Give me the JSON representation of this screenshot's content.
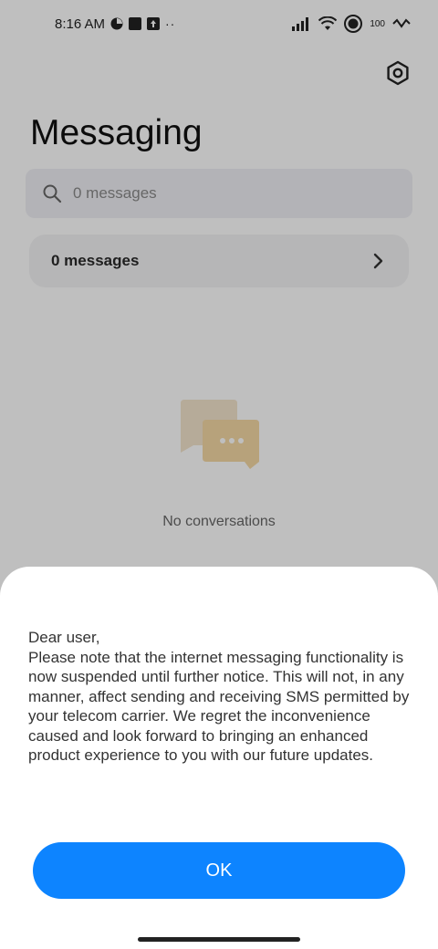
{
  "status_bar": {
    "time": "8:16 AM",
    "battery": "100"
  },
  "header": {
    "title": "Messaging"
  },
  "search": {
    "placeholder": "0 messages"
  },
  "messages_row": {
    "label": "0 messages"
  },
  "empty_state": {
    "text": "No conversations"
  },
  "dialog": {
    "body": "Dear user,\nPlease note that the internet messaging functionality is now suspended until further notice. This will not, in any manner, affect sending and receiving SMS permitted by your telecom carrier. We regret the inconvenience caused and look forward to bringing an enhanced product experience to you with our future updates.",
    "ok_label": "OK"
  },
  "colors": {
    "accent": "#0d84ff",
    "illustration_back": "#f3e4cd",
    "illustration_front": "#f5d9a5"
  }
}
